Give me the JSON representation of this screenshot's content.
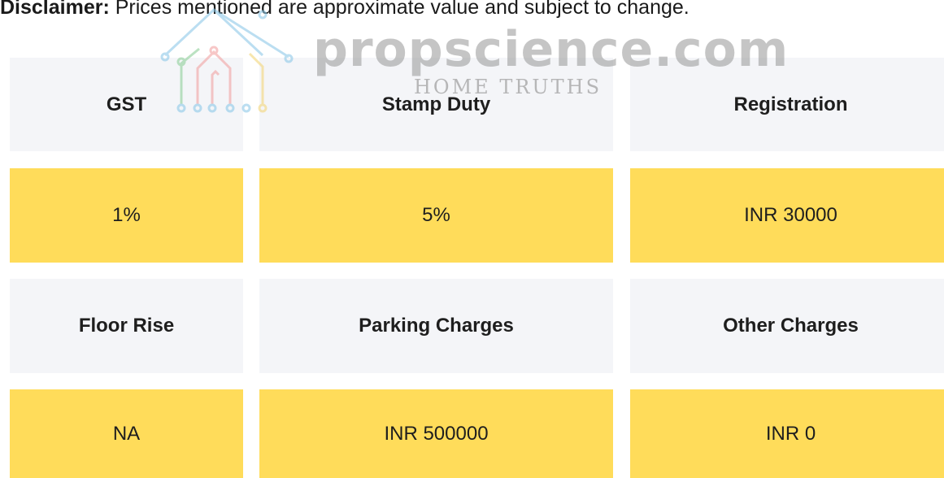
{
  "disclaimer": {
    "label": "Disclaimer:",
    "text": " Prices mentioned are approximate value and subject to change."
  },
  "watermark": {
    "brand": "propscience.com",
    "tagline": "HOME TRUTHS"
  },
  "charges": {
    "headers_row1": [
      "GST",
      "Stamp Duty",
      "Registration"
    ],
    "values_row1": [
      "1%",
      "5%",
      "INR 30000"
    ],
    "headers_row2": [
      "Floor Rise",
      "Parking Charges",
      "Other Charges"
    ],
    "values_row2": [
      "NA",
      "INR 500000",
      "INR 0"
    ]
  },
  "colors": {
    "header_bg": "#f4f5f8",
    "value_bg": "#ffdc5a"
  }
}
